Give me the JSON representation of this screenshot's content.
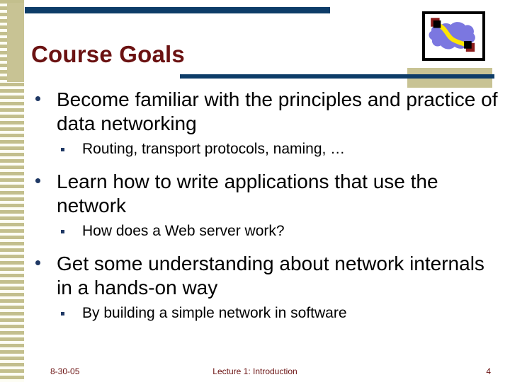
{
  "slide": {
    "title": "Course Goals",
    "bullets": [
      {
        "text": "Become familiar with the principles and practice of data networking",
        "sub": "Routing, transport protocols, naming, …"
      },
      {
        "text": "Learn how to write applications that use the network",
        "sub": "How does a Web server work?"
      },
      {
        "text": "Get some understanding about network internals in a hands-on way",
        "sub": "By building a simple network in software"
      }
    ],
    "footer": {
      "date": "8-30-05",
      "center": "Lecture 1: Introduction",
      "page": "4"
    },
    "clipart": {
      "name": "network-cloud-clipart",
      "cloud_color": "#7b77e0",
      "link_color": "#ffe600",
      "node_outer_color": "#8b1a1a",
      "node_inner_color": "#000000"
    },
    "colors": {
      "title": "#6b1212",
      "accent_rule": "#0d3c68",
      "khaki": "#c8c394",
      "bullet_mark": "#1f3864",
      "body_text": "#000000"
    }
  }
}
